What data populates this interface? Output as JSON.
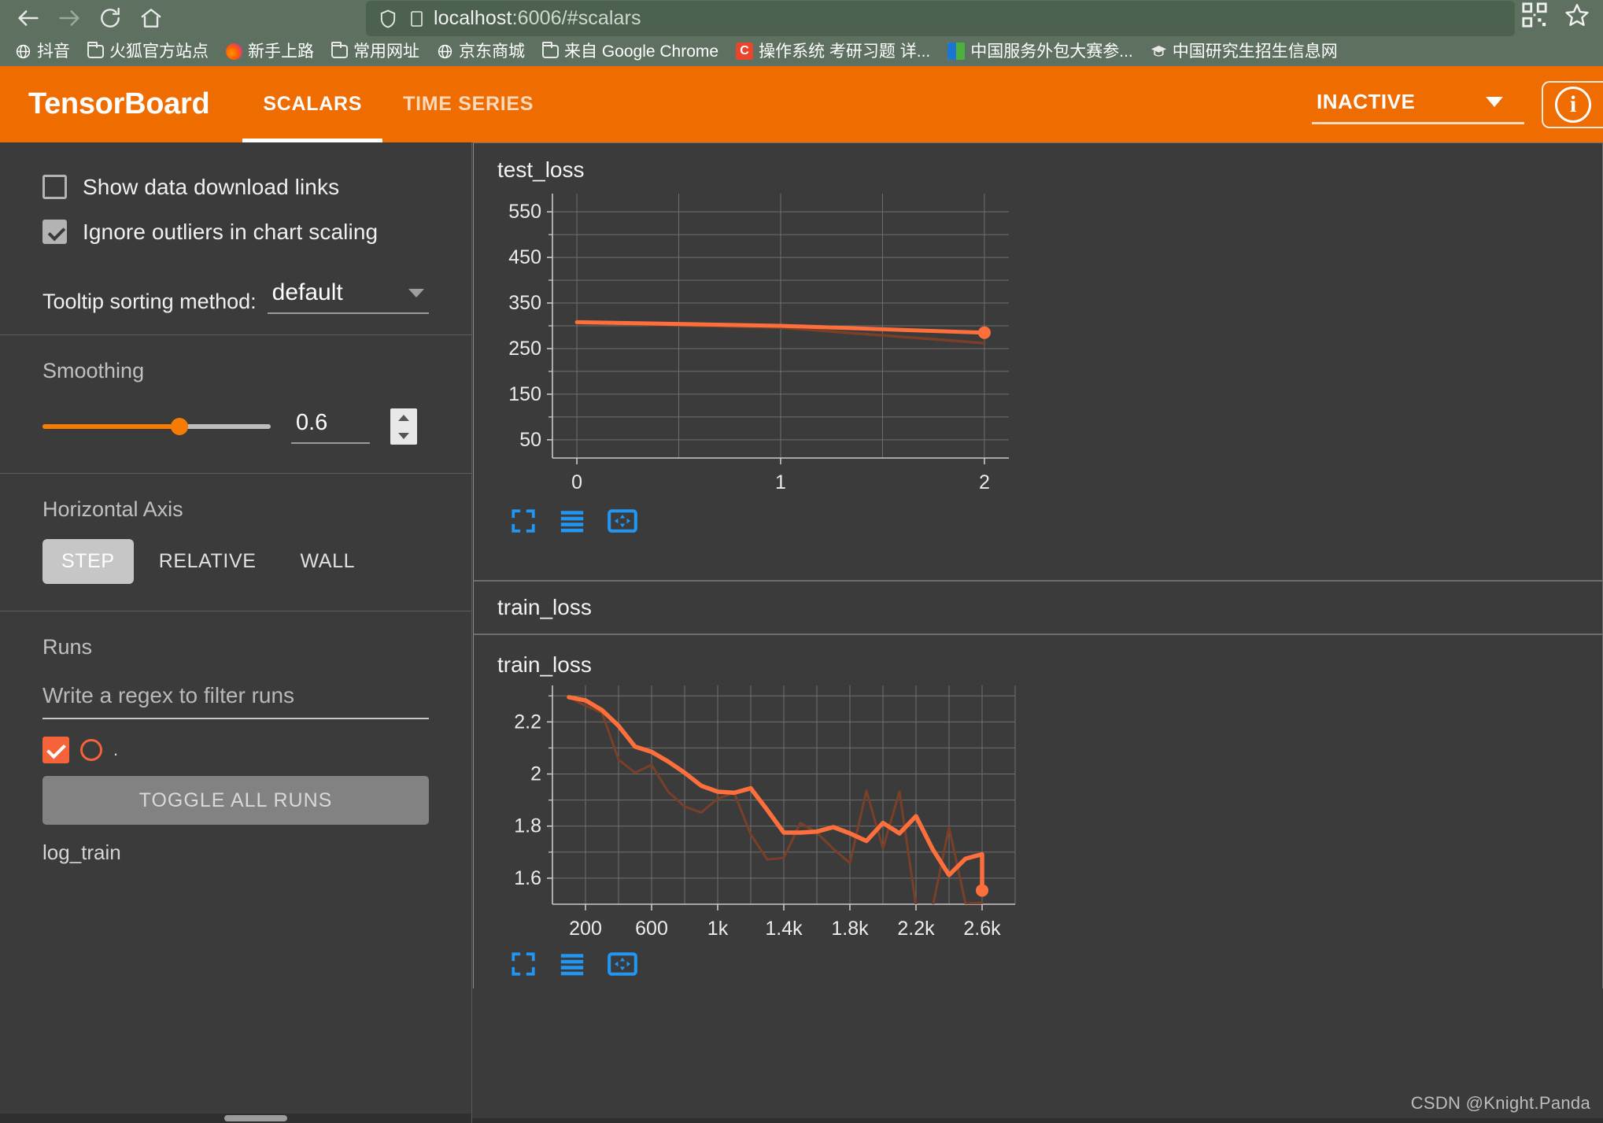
{
  "browser": {
    "url_host": "localhost",
    "url_rest": ":6006/#scalars",
    "url_full": "localhost:6006/#scalars",
    "nav": {
      "back": "back-arrow",
      "forward": "forward-arrow",
      "reload": "reload",
      "home": "home"
    },
    "right_icons": [
      "qr-code-icon",
      "bookmark-star-icon"
    ],
    "bookmarks": [
      {
        "label": "抖音",
        "icon": "globe-icon"
      },
      {
        "label": "火狐官方站点",
        "icon": "folder-icon"
      },
      {
        "label": "新手上路",
        "icon": "firefox-icon"
      },
      {
        "label": "常用网址",
        "icon": "folder-icon"
      },
      {
        "label": "京东商城",
        "icon": "globe-icon"
      },
      {
        "label": "来自 Google Chrome",
        "icon": "folder-icon"
      },
      {
        "label": "操作系统 考研习题 详...",
        "icon": "csdn-icon"
      },
      {
        "label": "中国服务外包大赛参...",
        "icon": "contest-icon"
      },
      {
        "label": "中国研究生招生信息网",
        "icon": "graduation-cap-icon"
      }
    ]
  },
  "header": {
    "brand": "TensorBoard",
    "tabs": [
      {
        "label": "SCALARS",
        "active": true
      },
      {
        "label": "TIME SERIES",
        "active": false
      }
    ],
    "run_status": "INACTIVE",
    "info_glyph": "i",
    "accent_color": "#ef6c00"
  },
  "sidebar": {
    "checkboxes": [
      {
        "label": "Show data download links",
        "checked": false
      },
      {
        "label": "Ignore outliers in chart scaling",
        "checked": true
      }
    ],
    "tooltip_sorting": {
      "label": "Tooltip sorting method:",
      "value": "default"
    },
    "smoothing": {
      "title": "Smoothing",
      "value": "0.6",
      "fraction": 0.6
    },
    "horizontal_axis": {
      "title": "Horizontal Axis",
      "options": [
        {
          "label": "STEP",
          "active": true
        },
        {
          "label": "RELATIVE",
          "active": false
        },
        {
          "label": "WALL",
          "active": false
        }
      ]
    },
    "runs": {
      "title": "Runs",
      "filter_placeholder": "Write a regex to filter runs",
      "selected_run_marker": ".",
      "toggle_all_label": "TOGGLE ALL RUNS",
      "run_name": "log_train"
    }
  },
  "main": {
    "group_header": "train_loss",
    "watermark": "CSDN @Knight.Panda",
    "toolbar_icons": [
      "fullscreen-icon",
      "data-table-icon",
      "pan-icon"
    ]
  },
  "chart_data": [
    {
      "type": "line",
      "title": "test_loss",
      "xlabel": "",
      "ylabel": "",
      "x": [
        0,
        1,
        2
      ],
      "xticks": [
        "0",
        "1",
        "2"
      ],
      "yticks": [
        "50",
        "150",
        "250",
        "350",
        "450",
        "550"
      ],
      "xlim": [
        -0.12,
        2.12
      ],
      "ylim": [
        10,
        590
      ],
      "grid": true,
      "legend": false,
      "series": [
        {
          "name": "log_train (smoothed)",
          "color": "#ff6f3c",
          "width": "bold",
          "values": [
            308,
            300,
            285
          ]
        },
        {
          "name": "log_train (raw)",
          "color": "#7a3f28",
          "width": "thin",
          "values": [
            306,
            296,
            262
          ]
        }
      ],
      "last_point_marker": {
        "x": 2,
        "y": 285
      }
    },
    {
      "type": "line",
      "title": "train_loss",
      "xlabel": "",
      "ylabel": "",
      "xticks": [
        "200",
        "600",
        "1k",
        "1.4k",
        "1.8k",
        "2.2k",
        "2.6k"
      ],
      "yticks": [
        "1.6",
        "1.8",
        "2",
        "2.2"
      ],
      "xlim": [
        0,
        2800
      ],
      "ylim": [
        1.5,
        2.34
      ],
      "grid": true,
      "legend": false,
      "series": [
        {
          "name": "log_train (smoothed)",
          "color": "#ff6f3c",
          "width": "bold",
          "x": [
            100,
            200,
            300,
            400,
            500,
            600,
            700,
            800,
            900,
            1000,
            1100,
            1200,
            1300,
            1400,
            1500,
            1600,
            1700,
            1800,
            1900,
            2000,
            2100,
            2200,
            2300,
            2400,
            2500,
            2600
          ],
          "values": [
            2.295,
            2.283,
            2.245,
            2.185,
            2.105,
            2.085,
            2.048,
            2.005,
            1.955,
            1.932,
            1.928,
            1.945,
            1.862,
            1.775,
            1.775,
            1.779,
            1.796,
            1.772,
            1.743,
            1.812,
            1.772,
            1.838,
            1.712,
            1.612,
            1.675,
            1.692,
            1.553
          ]
        },
        {
          "name": "log_train (raw)",
          "color": "#7a3f28",
          "width": "thin",
          "x": [
            100,
            200,
            300,
            400,
            500,
            600,
            700,
            800,
            900,
            1000,
            1100,
            1200,
            1300,
            1400,
            1500,
            1600,
            1700,
            1800,
            1900,
            2000,
            2100,
            2200,
            2300,
            2400,
            2500,
            2600
          ],
          "values": [
            2.295,
            2.262,
            2.235,
            2.055,
            2.005,
            2.035,
            1.932,
            1.875,
            1.852,
            1.905,
            1.928,
            1.768,
            1.672,
            1.678,
            1.812,
            1.775,
            1.712,
            1.658,
            1.935,
            1.715,
            1.932,
            1.495,
            1.488,
            1.795,
            1.502,
            1.505
          ]
        }
      ],
      "last_point_marker": {
        "x": 2600,
        "y": 1.553
      }
    }
  ]
}
